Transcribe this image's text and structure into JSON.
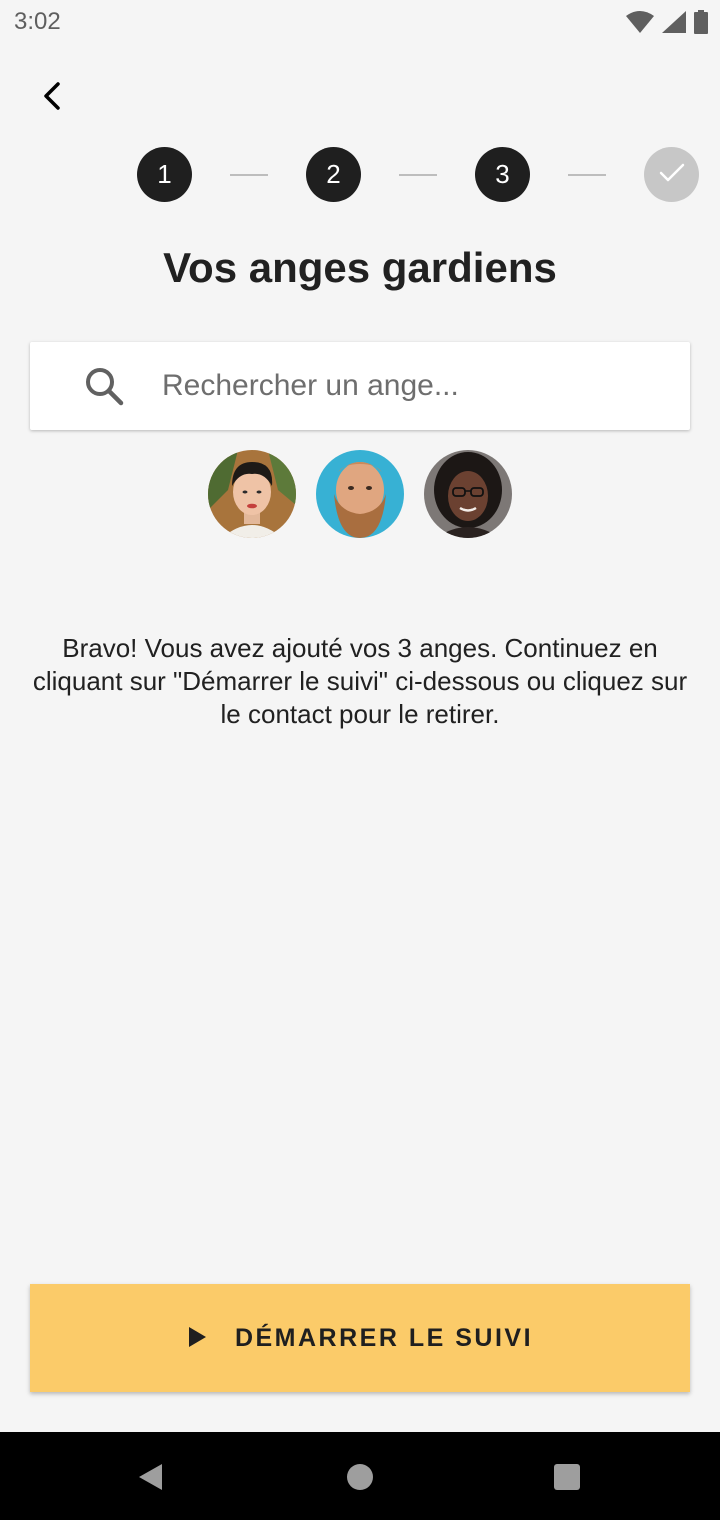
{
  "status_bar": {
    "time": "3:02",
    "icons": [
      "wifi-icon",
      "cellular-signal-icon",
      "battery-icon"
    ]
  },
  "header": {
    "back_icon": "chevron-left-icon"
  },
  "stepper": {
    "steps": [
      {
        "label": "1",
        "state": "complete"
      },
      {
        "label": "2",
        "state": "complete"
      },
      {
        "label": "3",
        "state": "complete"
      },
      {
        "label": "",
        "state": "pending",
        "icon": "check-icon"
      }
    ]
  },
  "title": "Vos anges gardiens",
  "search": {
    "placeholder": "Rechercher un ange...",
    "value": "",
    "icon": "search-icon"
  },
  "angels": [
    {
      "name": "angel-1"
    },
    {
      "name": "angel-2"
    },
    {
      "name": "angel-3"
    }
  ],
  "message": "Bravo! Vous avez ajouté vos 3 anges. Continuez en cliquant sur \"Démarrer le suivi\" ci-dessous ou cliquez sur le contact pour le retirer.",
  "start_button": {
    "label": "DÉMARRER LE SUIVI",
    "icon": "play-icon",
    "color": "#fbcb69"
  },
  "nav_bar": {
    "icons": [
      "back-triangle-icon",
      "home-circle-icon",
      "recents-square-icon"
    ]
  }
}
